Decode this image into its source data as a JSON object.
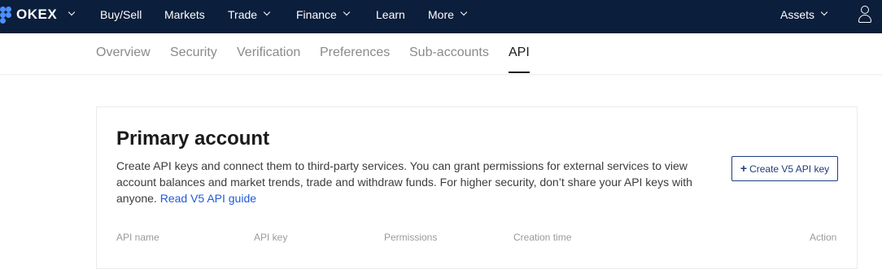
{
  "topnav": {
    "brand": "OKEX",
    "items": [
      {
        "label": "Buy/Sell"
      },
      {
        "label": "Markets"
      },
      {
        "label": "Trade"
      },
      {
        "label": "Finance"
      },
      {
        "label": "Learn"
      },
      {
        "label": "More"
      }
    ],
    "assets_label": "Assets",
    "icons": {
      "brand_dropdown": "chevron-down-icon",
      "user": "user-icon"
    },
    "colors": {
      "bar_bg": "#0b1e3b",
      "logo_accent": "#4a90ff"
    }
  },
  "subnav": {
    "tabs": [
      {
        "label": "Overview"
      },
      {
        "label": "Security"
      },
      {
        "label": "Verification"
      },
      {
        "label": "Preferences"
      },
      {
        "label": "Sub-accounts"
      },
      {
        "label": "API",
        "active": true
      }
    ]
  },
  "main": {
    "title": "Primary account",
    "description": "Create API keys and connect them to third-party services. You can grant permissions for external services to view account balances and market trends, trade and withdraw funds. For higher security, don’t share your API keys with anyone.",
    "guide_link": "Read V5 API guide",
    "create_button": "Create V5 API key",
    "table": {
      "columns": [
        "API name",
        "API key",
        "Permissions",
        "Creation time",
        "Action"
      ]
    },
    "colors": {
      "link": "#1f5bd9",
      "button_border": "#1f3d7a"
    }
  }
}
